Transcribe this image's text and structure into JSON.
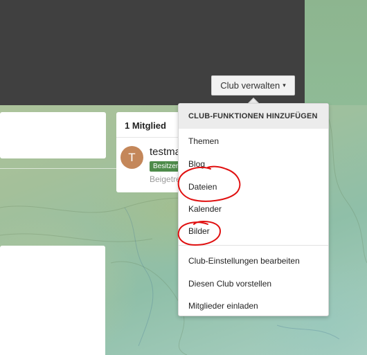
{
  "header": {
    "manage_button_label": "Club verwalten",
    "caret_glyph": "▾"
  },
  "members": {
    "title": "1 Mitglied",
    "avatar_initial": "T",
    "name": "testma",
    "badge": "Besitzer",
    "joined": "Beigetreten"
  },
  "dropdown": {
    "section_title": "CLUB-FUNKTIONEN HINZUFÜGEN",
    "features": [
      "Themen",
      "Blog",
      "Dateien",
      "Kalender",
      "Bilder"
    ],
    "actions": [
      "Club-Einstellungen bearbeiten",
      "Diesen Club vorstellen",
      "Mitglieder einladen"
    ]
  },
  "colors": {
    "header_dark": "#404040",
    "badge_green": "#4e8b4a",
    "annotation_red": "#e01010"
  }
}
